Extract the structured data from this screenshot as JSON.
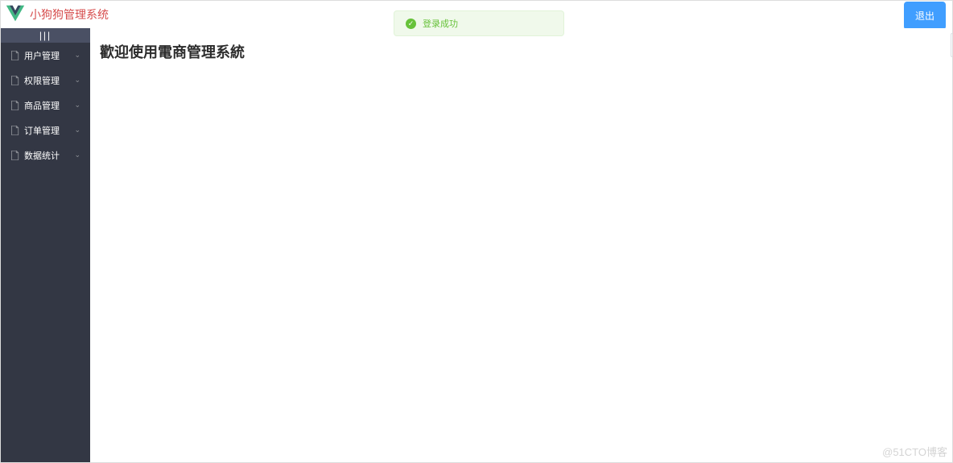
{
  "header": {
    "app_title": "小狗狗管理系统",
    "logout_label": "退出"
  },
  "sidebar": {
    "collapse_label": "|||",
    "items": [
      {
        "label": "用户管理"
      },
      {
        "label": "权限管理"
      },
      {
        "label": "商品管理"
      },
      {
        "label": "订单管理"
      },
      {
        "label": "数据统计"
      }
    ]
  },
  "main": {
    "welcome_title": "歡迎使用電商管理系統"
  },
  "toast": {
    "message": "登录成功"
  },
  "watermark": "@51CTO博客"
}
